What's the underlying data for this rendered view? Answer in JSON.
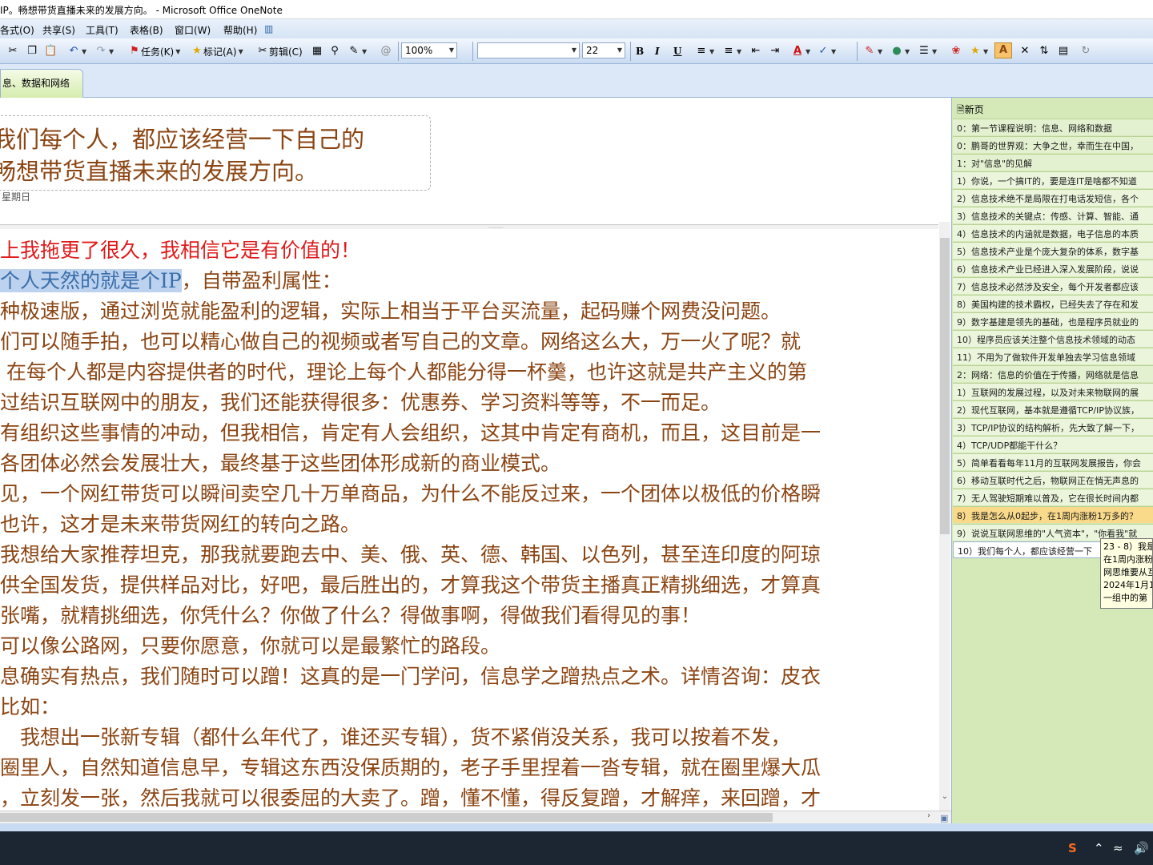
{
  "window": {
    "title": "IP。畅想带货直播未来的发展方向。 - Microsoft Office OneNote"
  },
  "menu": {
    "items": [
      "各式(O)",
      "共享(S)",
      "工具(T)",
      "表格(B)",
      "窗口(W)",
      "帮助(H)"
    ]
  },
  "toolbar": {
    "task_label": "任务(K)",
    "tag_label": "标记(A)",
    "clip_label": "剪辑(C)",
    "zoom": "100%",
    "font_name": "",
    "font_size": "22",
    "bold": "B",
    "italic": "I",
    "underline": "U",
    "highlight": "A"
  },
  "section_tab": {
    "label": "息、数据和网络"
  },
  "page": {
    "title_lines": [
      "我们每个人，都应该经营一下自己的",
      "畅想带货直播未来的发展方向。"
    ],
    "date": "星期日",
    "body": [
      {
        "text": "上我拖更了很久，我相信它是有价值的！",
        "color": "#e01b1b"
      },
      {
        "text_highlighted": "个人天然的就是个IP",
        "text_after": "，自带盈利属性："
      },
      {
        "text": "种极速版，通过浏览就能盈利的逻辑，实际上相当于平台买流量，起码赚个网费没问题。"
      },
      {
        "text": "们可以随手拍，也可以精心做自己的视频或者写自己的文章。网络这么大，万一火了呢？就"
      },
      {
        "text": "在每个人都是内容提供者的时代，理论上每个人都能分得一杯羹，也许这就是共产主义的第"
      },
      {
        "text": "过结识互联网中的朋友，我们还能获得很多：优惠券、学习资料等等，不一而足。"
      },
      {
        "text": "有组织这些事情的冲动，但我相信，肯定有人会组织，这其中肯定有商机，而且，这目前是一"
      },
      {
        "text": "各团体必然会发展壮大，最终基于这些团体形成新的商业模式。"
      },
      {
        "text": "见，一个网红带货可以瞬间卖空几十万单商品，为什么不能反过来，一个团体以极低的价格瞬"
      },
      {
        "text": "也许，这才是未来带货网红的转向之路。"
      },
      {
        "text": "我想给大家推荐坦克，那我就要跑去中、美、俄、英、德、韩国、以色列，甚至连印度的阿琼"
      },
      {
        "text": "供全国发货，提供样品对比，好吧，最后胜出的，才算我这个带货主播真正精挑细选，才算真"
      },
      {
        "text": "张嘴，就精挑细选，你凭什么？你做了什么？得做事啊，得做我们看得见的事！"
      },
      {
        "text": "可以像公路网，只要你愿意，你就可以是最繁忙的路段。"
      },
      {
        "text": "息确实有热点，我们随时可以蹭！这真的是一门学问，信息学之蹭热点之术。详情咨询：皮衣"
      },
      {
        "text": "比如："
      },
      {
        "text": "　我想出一张新专辑（都什么年代了，谁还买专辑），货不紧俏没关系，我可以按着不发，"
      },
      {
        "text": "圈里人，自然知道信息早，专辑这东西没保质期的，老子手里捏着一沓专辑，就在圈里爆大瓜"
      },
      {
        "text": "，立刻发一张，然后我就可以很委屈的大卖了。蹭，懂不懂，得反复蹭，才解痒，来回蹭，才"
      }
    ]
  },
  "page_tabs": {
    "new_page_label": "新页",
    "items": [
      {
        "label": "0：第一节课程说明：信息、网络和数据",
        "state": "level-0"
      },
      {
        "label": "0：鹏哥的世界观：大争之世，幸而生在中国，",
        "state": "level-0"
      },
      {
        "label": "1：对\"信息\"的见解",
        "state": "level-0"
      },
      {
        "label": "1）你说，一个搞IT的，要是连IT是啥都不知道",
        "state": "normal"
      },
      {
        "label": "2）信息技术绝不是局限在打电话发短信，各个",
        "state": "normal"
      },
      {
        "label": "3）信息技术的关键点：传感、计算、智能、通",
        "state": "normal"
      },
      {
        "label": "4）信息技术的内涵就是数据，电子信息的本质",
        "state": "normal"
      },
      {
        "label": "5）信息技术产业是个庞大复杂的体系，数字基",
        "state": "normal"
      },
      {
        "label": "6）信息技术产业已经进入深入发展阶段，说说",
        "state": "normal"
      },
      {
        "label": "7）信息技术必然涉及安全，每个开发者都应该",
        "state": "normal"
      },
      {
        "label": "8）美国构建的技术霸权，已经失去了存在和发",
        "state": "normal"
      },
      {
        "label": "9）数字基建是领先的基础，也是程序员就业的",
        "state": "normal"
      },
      {
        "label": "10）程序员应该关注整个信息技术领域的动态",
        "state": "normal"
      },
      {
        "label": "11）不用为了做软件开发单独去学习信息领域",
        "state": "normal"
      },
      {
        "label": "2：网络：信息的价值在于传播，网络就是信息",
        "state": "level-0"
      },
      {
        "label": "1）互联网的发展过程，以及对未来物联网的展",
        "state": "normal"
      },
      {
        "label": "2）现代互联网，基本就是遵循TCP/IP协议族，",
        "state": "normal"
      },
      {
        "label": "3）TCP/IP协议的结构解析，先大致了解一下，",
        "state": "normal"
      },
      {
        "label": "4）TCP/UDP都能干什么？",
        "state": "normal"
      },
      {
        "label": "5）简单看看每年11月的互联网发展报告，你会",
        "state": "normal"
      },
      {
        "label": "6）移动互联时代之后，物联网正在悄无声息的",
        "state": "normal"
      },
      {
        "label": "7）无人驾驶短期难以普及，它在很长时间内都",
        "state": "normal"
      },
      {
        "label": "8）我是怎么从0起步，在1周内涨粉1万多的？",
        "state": "selected"
      },
      {
        "label": "9）说说互联网思维的\"人气资本\"，\"你看我\"就",
        "state": "normal"
      },
      {
        "label": "10）我们每个人，都应该经营一下",
        "state": "current"
      }
    ]
  },
  "tooltip": {
    "lines": [
      "23 - 8）我是",
      "在1周内涨粉",
      "网思维要从互",
      "2024年1月1",
      "一组中的第"
    ]
  },
  "colors": {
    "body_text": "#8b4513",
    "emphasis_red": "#e01b1b",
    "selection": "#bcd2ee",
    "page_panel": "#d4e8b8",
    "selected_tab": "#f9d98a"
  },
  "icons": [
    "cut-icon",
    "copy-icon",
    "paste-icon",
    "undo-icon",
    "redo-icon",
    "flag-icon",
    "star-icon",
    "clip-icon",
    "table-icon",
    "search-icon",
    "pen-icon",
    "bullets-icon",
    "numbering-icon",
    "font-color-icon",
    "close-icon"
  ]
}
